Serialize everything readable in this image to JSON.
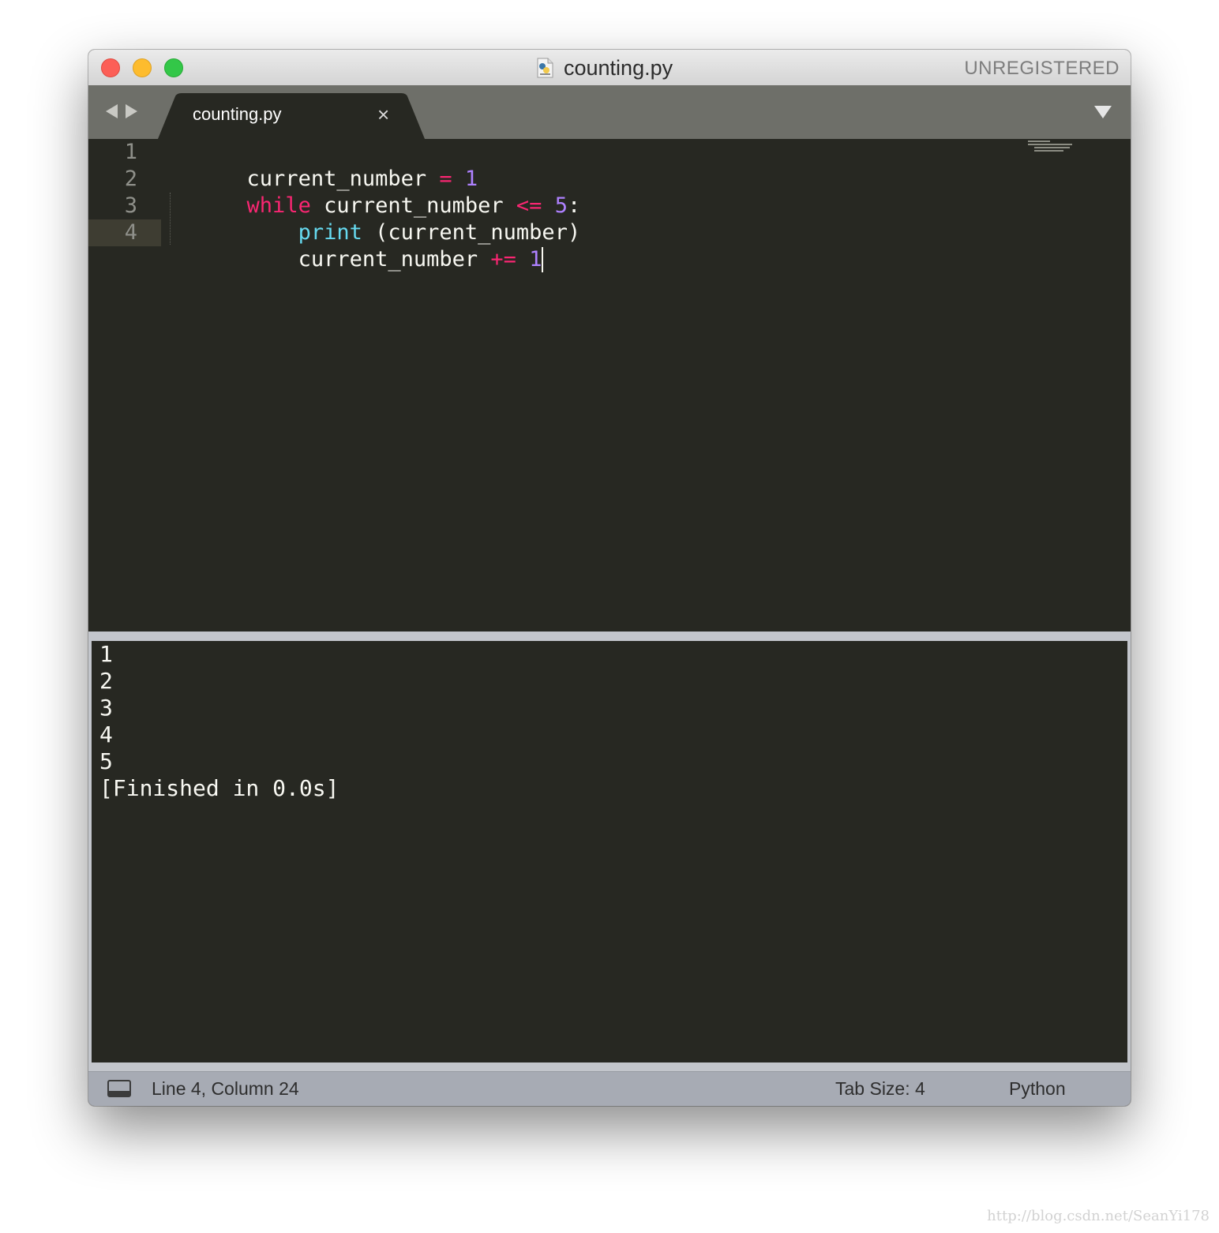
{
  "window": {
    "title": "counting.py",
    "license_status": "UNREGISTERED"
  },
  "tabs": [
    {
      "label": "counting.py",
      "active": true,
      "close_glyph": "×"
    }
  ],
  "editor": {
    "language": "Python",
    "current_line": 4,
    "line_numbers": [
      "1",
      "2",
      "3",
      "4"
    ],
    "lines": [
      [
        {
          "text": "current_number",
          "type": "plain"
        },
        {
          "text": " ",
          "type": "plain"
        },
        {
          "text": "=",
          "type": "op"
        },
        {
          "text": " ",
          "type": "plain"
        },
        {
          "text": "1",
          "type": "num"
        }
      ],
      [
        {
          "text": "while",
          "type": "kw"
        },
        {
          "text": " current_number ",
          "type": "plain"
        },
        {
          "text": "<=",
          "type": "op"
        },
        {
          "text": " ",
          "type": "plain"
        },
        {
          "text": "5",
          "type": "num"
        },
        {
          "text": ":",
          "type": "plain"
        }
      ],
      [
        {
          "text": "    ",
          "type": "plain"
        },
        {
          "text": "print",
          "type": "fn"
        },
        {
          "text": " (current_number)",
          "type": "plain"
        }
      ],
      [
        {
          "text": "    current_number ",
          "type": "plain"
        },
        {
          "text": "+=",
          "type": "op"
        },
        {
          "text": " ",
          "type": "plain"
        },
        {
          "text": "1",
          "type": "num"
        }
      ]
    ]
  },
  "output": {
    "lines": [
      "1",
      "2",
      "3",
      "4",
      "5",
      "[Finished in 0.0s]"
    ]
  },
  "statusbar": {
    "position": "Line 4, Column 24",
    "tab_size": "Tab Size: 4",
    "syntax": "Python"
  },
  "watermark": "http://blog.csdn.net/SeanYi178",
  "colors": {
    "background": "#272822",
    "keyword": "#f92672",
    "number": "#ae81ff",
    "function": "#66d9ef",
    "text": "#f8f8f2",
    "close": "#fc5f57",
    "minimize": "#fdbc2e",
    "maximize": "#33c748"
  }
}
